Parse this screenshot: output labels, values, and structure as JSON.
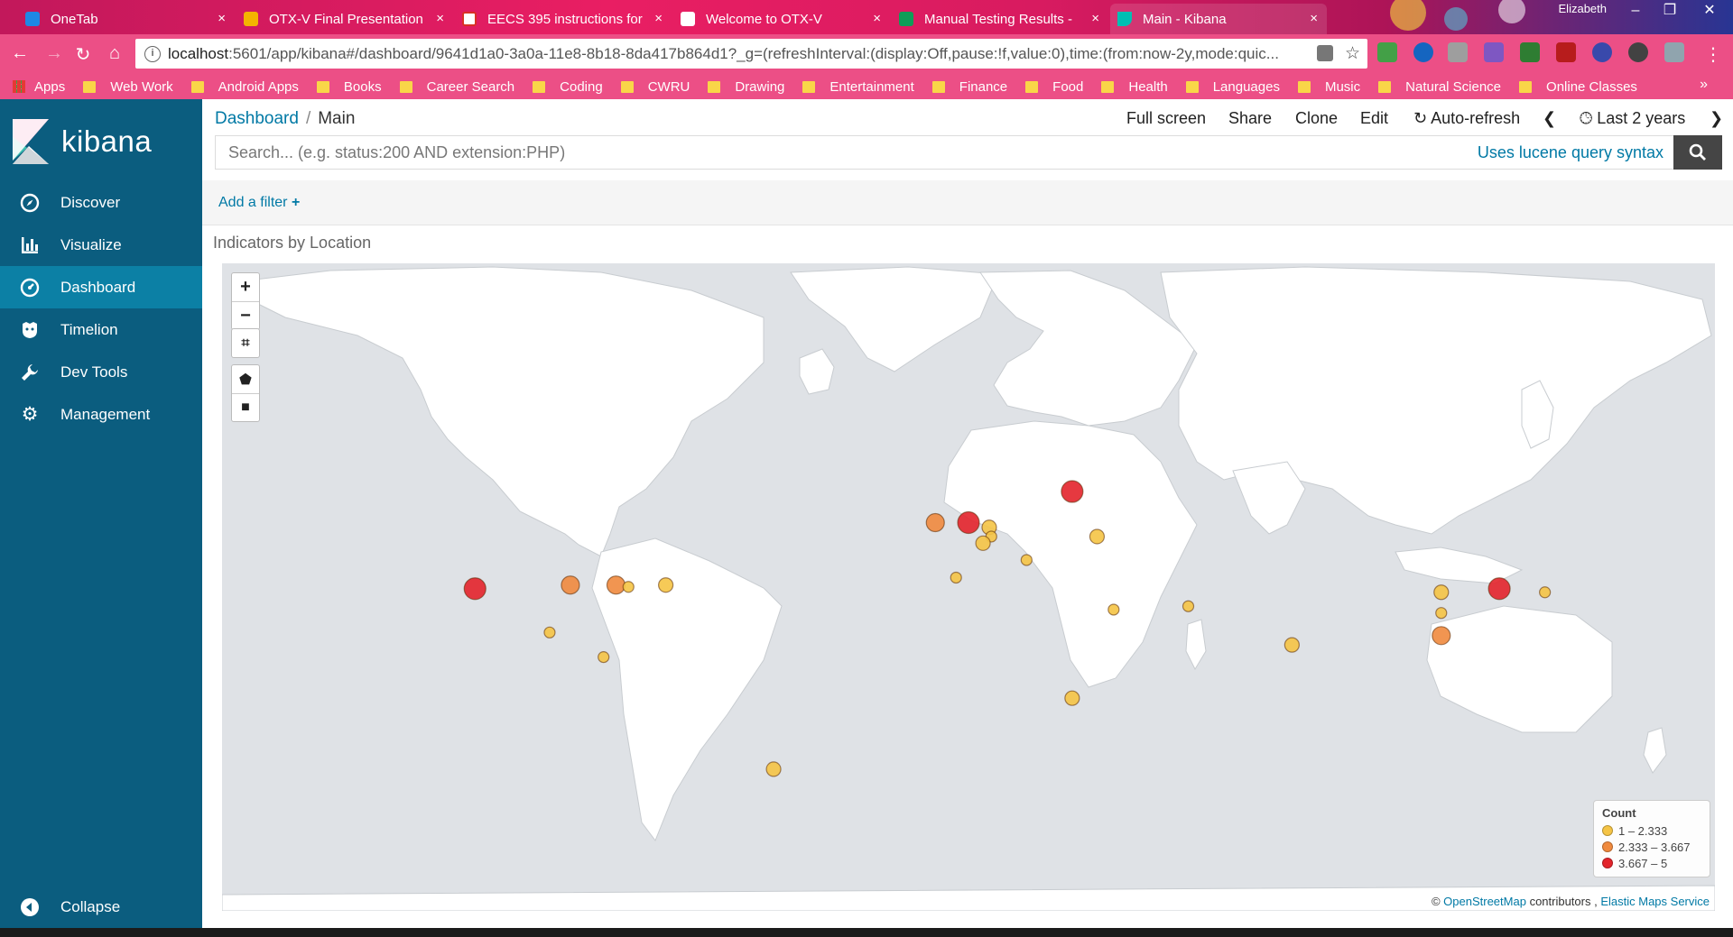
{
  "browser": {
    "tabs": [
      {
        "title": "OneTab",
        "icon": "onetab-icon",
        "color": "#1e88e5"
      },
      {
        "title": "OTX-V Final Presentation",
        "icon": "slides-icon",
        "color": "#f4b400"
      },
      {
        "title": "EECS 395 instructions for",
        "icon": "gmail-icon",
        "color": "#ffffff"
      },
      {
        "title": "Welcome to OTX-V",
        "icon": "doc-icon",
        "color": "#ffffff"
      },
      {
        "title": "Manual Testing Results -",
        "icon": "sheets-icon",
        "color": "#0f9d58"
      },
      {
        "title": "Main - Kibana",
        "icon": "kibana-icon",
        "color": "#00bfb3"
      }
    ],
    "user": "Elizabeth",
    "url_host": "localhost",
    "url_rest": ":5601/app/kibana#/dashboard/9641d1a0-3a0a-11e8-8b18-8da417b864d1?_g=(refreshInterval:(display:Off,pause:!f,value:0),time:(from:now-2y,mode:quic...",
    "bookmarks": [
      "Web Work",
      "Android Apps",
      "Books",
      "Career Search",
      "Coding",
      "CWRU",
      "Drawing",
      "Entertainment",
      "Finance",
      "Food",
      "Health",
      "Languages",
      "Music",
      "Natural Science",
      "Online Classes"
    ],
    "apps_label": "Apps"
  },
  "sidebar": {
    "brand": "kibana",
    "items": [
      {
        "label": "Discover",
        "icon": "compass-icon"
      },
      {
        "label": "Visualize",
        "icon": "bar-chart-icon"
      },
      {
        "label": "Dashboard",
        "icon": "dashboard-icon",
        "active": true
      },
      {
        "label": "Timelion",
        "icon": "timelion-icon"
      },
      {
        "label": "Dev Tools",
        "icon": "wrench-icon"
      },
      {
        "label": "Management",
        "icon": "gear-icon"
      }
    ],
    "collapse_label": "Collapse"
  },
  "topnav": {
    "crumb_root": "Dashboard",
    "crumb_sep": "/",
    "crumb_current": "Main",
    "full_screen": "Full screen",
    "share": "Share",
    "clone": "Clone",
    "edit": "Edit",
    "auto_refresh": "Auto-refresh",
    "time_range": "Last 2 years"
  },
  "search": {
    "placeholder": "Search... (e.g. status:200 AND extension:PHP)",
    "syntax_link": "Uses lucene query syntax"
  },
  "filter": {
    "add_label": "Add a filter"
  },
  "panel": {
    "title": "Indicators by Location"
  },
  "legend": {
    "title": "Count",
    "ranges": [
      {
        "label": "1 – 2.333",
        "color": "#f5c445"
      },
      {
        "label": "2.333 – 3.667",
        "color": "#f08a3e"
      },
      {
        "label": "3.667 – 5",
        "color": "#e3242b"
      }
    ]
  },
  "attribution": {
    "prefix": "©",
    "osm": "OpenStreetMap",
    "contributors": "contributors ,",
    "ems": "Elastic Maps Service"
  },
  "map_points": [
    {
      "place": "Western US",
      "lon": -119,
      "lat": 37,
      "bucket": 2
    },
    {
      "place": "Central US",
      "lon": -96,
      "lat": 38,
      "bucket": 1
    },
    {
      "place": "Eastern US",
      "lon": -85,
      "lat": 38,
      "bucket": 1
    },
    {
      "place": "Eastern US 2",
      "lon": -82,
      "lat": 37.5,
      "bucket": 0
    },
    {
      "place": "US East Coast",
      "lon": -73,
      "lat": 38,
      "bucket": 0
    },
    {
      "place": "Mexico",
      "lon": -101,
      "lat": 24,
      "bucket": 0
    },
    {
      "place": "Central America",
      "lon": -88,
      "lat": 16,
      "bucket": 0
    },
    {
      "place": "Ireland",
      "lon": -8,
      "lat": 53,
      "bucket": 1
    },
    {
      "place": "United Kingdom",
      "lon": 0,
      "lat": 53,
      "bucket": 2
    },
    {
      "place": "Netherlands",
      "lon": 5,
      "lat": 52,
      "bucket": 0
    },
    {
      "place": "Belgium",
      "lon": 5.5,
      "lat": 50,
      "bucket": 0
    },
    {
      "place": "France",
      "lon": 3.5,
      "lat": 48.5,
      "bucket": 0
    },
    {
      "place": "Spain",
      "lon": -3,
      "lat": 40,
      "bucket": 0
    },
    {
      "place": "Italy",
      "lon": 14,
      "lat": 44.5,
      "bucket": 0
    },
    {
      "place": "Estonia",
      "lon": 25,
      "lat": 59,
      "bucket": 2
    },
    {
      "place": "Ukraine",
      "lon": 31,
      "lat": 50,
      "bucket": 0
    },
    {
      "place": "Israel",
      "lon": 35,
      "lat": 31,
      "bucket": 0
    },
    {
      "place": "Iran",
      "lon": 53,
      "lat": 32,
      "bucket": 0
    },
    {
      "place": "India",
      "lon": 78,
      "lat": 20,
      "bucket": 0
    },
    {
      "place": "Cameroon",
      "lon": 25,
      "lat": 2,
      "bucket": 0
    },
    {
      "place": "Brazil",
      "lon": -47,
      "lat": -22,
      "bucket": 0
    },
    {
      "place": "Northern China",
      "lon": 114,
      "lat": 36,
      "bucket": 0
    },
    {
      "place": "Central China",
      "lon": 114,
      "lat": 30,
      "bucket": 0
    },
    {
      "place": "Southern China",
      "lon": 114,
      "lat": 23,
      "bucket": 1
    },
    {
      "place": "Korea",
      "lon": 128,
      "lat": 37,
      "bucket": 2
    },
    {
      "place": "Japan",
      "lon": 139,
      "lat": 36,
      "bucket": 0
    }
  ]
}
